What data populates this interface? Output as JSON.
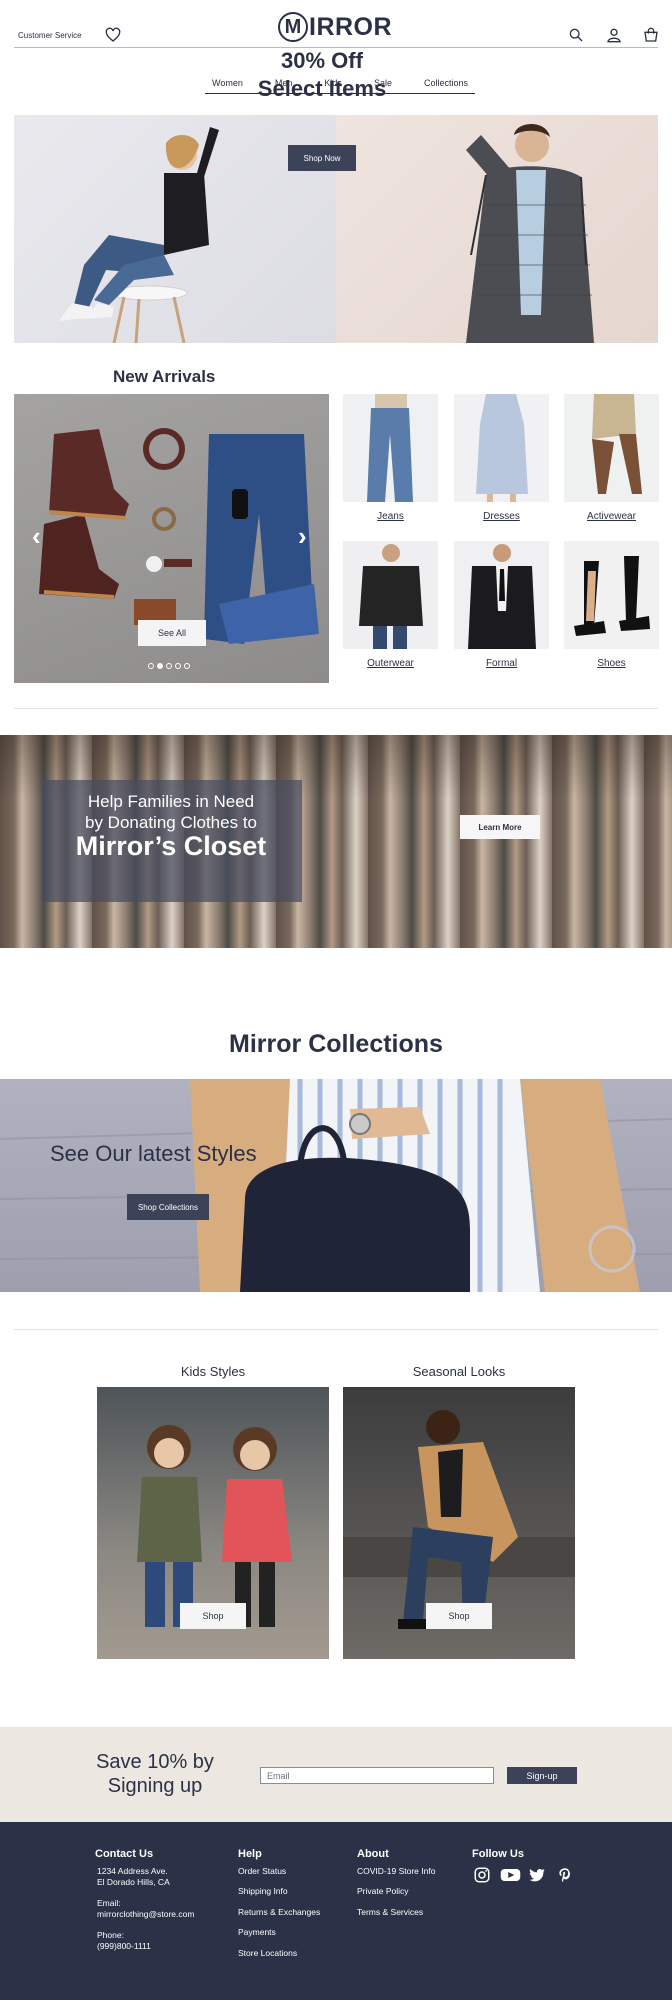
{
  "header": {
    "customer_service": "Customer Service",
    "logo_letter": "M",
    "logo_text": "IRROR"
  },
  "nav": {
    "items": [
      "Women",
      "Men",
      "Kids",
      "Sale",
      "Collections"
    ]
  },
  "hero": {
    "line1": "30% Off",
    "line2": "Select Items",
    "button": "Shop Now"
  },
  "new_arrivals": {
    "title": "New Arrivals",
    "see_all": "See All",
    "prev_arrow": "‹",
    "next_arrow": "›",
    "slide_count": 5,
    "active_slide": 2,
    "categories": [
      "Jeans",
      "Dresses",
      "Activewear",
      "Outerwear",
      "Formal",
      "Shoes"
    ]
  },
  "donation": {
    "line1": "Help Families in Need",
    "line2": "by Donating Clothes to",
    "line3": "Mirror’s Closet",
    "button": "Learn More"
  },
  "collections": {
    "title": "Mirror Collections",
    "tagline": "See Our latest Styles",
    "button": "Shop Collections",
    "kids": {
      "title": "Kids Styles",
      "button": "Shop"
    },
    "seasonal": {
      "title": "Seasonal Looks",
      "button": "Shop"
    }
  },
  "signup": {
    "line1": "Save 10% by",
    "line2": "Signing up",
    "email_placeholder": "Email",
    "button": "Sign-up"
  },
  "footer": {
    "contact": {
      "title": "Contact Us",
      "address1": "1234 Address Ave.",
      "address2": "El Dorado Hills, CA",
      "email_label": "Email:",
      "email": "mirrorclothing@store.com",
      "phone_label": "Phone:",
      "phone": "(999)800-1111"
    },
    "help": {
      "title": "Help",
      "links": [
        "Order Status",
        "Shipping Info",
        "Returns & Exchanges",
        "Payments",
        "Store Locations"
      ]
    },
    "about": {
      "title": "About",
      "links": [
        "COVID-19 Store Info",
        "Private Policy",
        "Terms & Services"
      ]
    },
    "follow": {
      "title": "Follow Us",
      "icons": [
        "instagram-icon",
        "youtube-icon",
        "twitter-icon",
        "pinterest-icon"
      ]
    }
  },
  "colors": {
    "navy": "#2b3146",
    "button": "#3c4258",
    "signup_bg": "#ede7e1"
  }
}
